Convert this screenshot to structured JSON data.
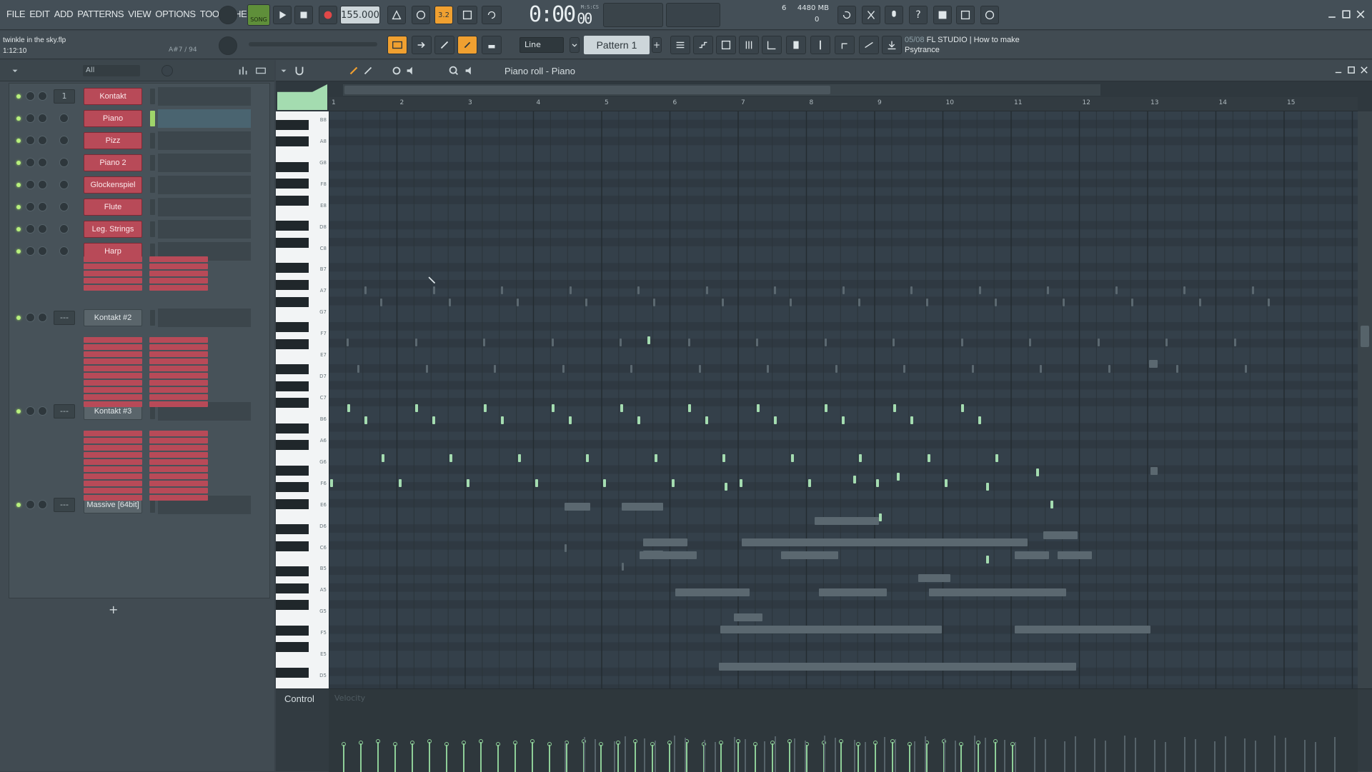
{
  "menu": [
    "FILE",
    "EDIT",
    "ADD",
    "PATTERNS",
    "VIEW",
    "OPTIONS",
    "TOOLS",
    "HELP"
  ],
  "transport": {
    "mode": "SONG",
    "tempo": "155.000",
    "time": "0:00",
    "time_sub": "00",
    "time_unit": "M:S:CS",
    "cpu": "6",
    "memory": "4480 MB",
    "voices": "0"
  },
  "song": {
    "file": "twinkle in the sky.flp",
    "time": "1:12:10",
    "position": "A#7 / 94"
  },
  "snap": "Line",
  "pattern": "Pattern 1",
  "hint": {
    "counter": "05/08",
    "text": "FL STUDIO | How to make Psytrance"
  },
  "rack": {
    "filter": "All",
    "channels": [
      {
        "num": "1",
        "name": "Kontakt"
      },
      {
        "num": "",
        "name": "Piano"
      },
      {
        "num": "",
        "name": "Pizz"
      },
      {
        "num": "",
        "name": "Piano 2"
      },
      {
        "num": "",
        "name": "Glockenspiel"
      },
      {
        "num": "",
        "name": "Flute"
      },
      {
        "num": "",
        "name": "Leg. Strings"
      },
      {
        "num": "",
        "name": "Harp"
      },
      {
        "num": "---",
        "name": "Kontakt #2"
      },
      {
        "num": "---",
        "name": "Kontakt #3"
      },
      {
        "num": "---",
        "name": "Massive [64bit]"
      }
    ],
    "add_label": "+"
  },
  "pianoroll": {
    "title": "Piano roll - Piano",
    "bars": [
      "1",
      "2",
      "3",
      "4",
      "5",
      "6",
      "7",
      "8",
      "9",
      "10",
      "11",
      "12",
      "13",
      "14",
      "15"
    ],
    "key_labels": [
      "B8",
      "A8",
      "G8",
      "F8",
      "E8",
      "D8",
      "C8",
      "B7",
      "A7",
      "G7",
      "F7",
      "E7",
      "D7",
      "C7",
      "B6",
      "A6",
      "G6",
      "F6",
      "E6",
      "D6",
      "C6",
      "B5",
      "A5",
      "G5",
      "F5",
      "E5",
      "D5"
    ],
    "control_label": "Control",
    "control_target": "Velocity"
  },
  "colors": {
    "note": "#a4dcb0",
    "channel": "#b84a58",
    "accent": "#f0a030"
  }
}
